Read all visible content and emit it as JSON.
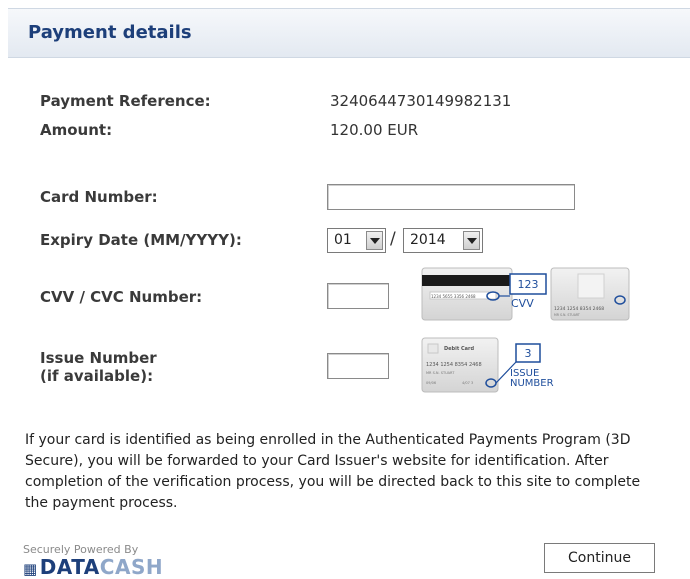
{
  "header": {
    "title": "Payment details"
  },
  "payment": {
    "reference_label": "Payment Reference:",
    "reference_value": "3240644730149982131",
    "amount_label": "Amount:",
    "amount_value": "120.00 EUR"
  },
  "form": {
    "card_number_label": "Card Number:",
    "card_number_value": "",
    "expiry_label": "Expiry Date (MM/YYYY):",
    "expiry_month": "01",
    "expiry_year": "2014",
    "expiry_separator": "/",
    "cvv_label": "CVV / CVC Number:",
    "cvv_value": "",
    "issue_label_line1": "Issue Number",
    "issue_label_line2": "(if available):",
    "issue_value": ""
  },
  "cvv_illustration": {
    "code": "123",
    "caption": "CVV",
    "back_card_digits": "1234 5655 3356 2468",
    "front_card_digits": "1234 1254 8354 2468",
    "front_card_small": "MR S.N. STUART"
  },
  "issue_illustration": {
    "code": "3",
    "caption_line1": "ISSUE",
    "caption_line2": "NUMBER",
    "card_title": "Debit Card",
    "card_digits": "1234 1254 8354 2468",
    "card_name": "MR S.N. STUART",
    "card_small_left": "09/06",
    "card_small_right": "4/07 3"
  },
  "note": "If your card is identified as being enrolled in the Authenticated Payments Program (3D Secure), you will be forwarded to your Card Issuer's website for identification. After completion of the verification process, you will be directed back to this site to complete the payment process.",
  "footer": {
    "powered_by": "Securely Powered By",
    "brand_strong": "DATA",
    "brand_light": "CASH",
    "continue_label": "Continue"
  },
  "colors": {
    "header_title": "#1d3f7a",
    "illustration_blue": "#1f4e9c"
  }
}
